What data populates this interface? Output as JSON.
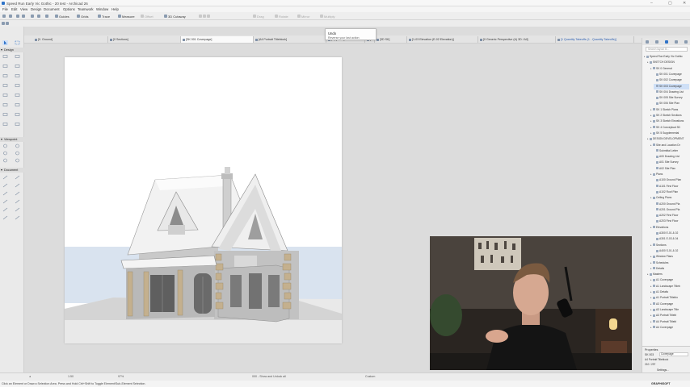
{
  "window": {
    "title": "Speed Run Early Vic Gothic - 20 test - Archicad 26",
    "controls": [
      "–",
      "▢",
      "✕"
    ]
  },
  "menu": [
    "File",
    "Edit",
    "View",
    "Design",
    "Document",
    "Options",
    "Teamwork",
    "Window",
    "Help"
  ],
  "toolbar": {
    "guides": "Guides",
    "grids": "Grids",
    "trace": "Trace",
    "measure": "Measure",
    "offset": "Offset",
    "cutaway": "3D Cutaway",
    "drag": "Drag",
    "rotate": "Rotate",
    "mirror": "Mirror",
    "multiply": "Multiply"
  },
  "tooltip": {
    "title": "Undo",
    "desc": "Reverse your last action"
  },
  "tabs": [
    "[0. Ground]",
    "[0 Sections]",
    "[SK 001 Coverpage]",
    "[A4 Portrait Titleblock]",
    "(A) [Undo]",
    "[3D / All]",
    "[3D SK]",
    "[1-03 Elevation (E-02 Elevation)]",
    "[0 Generic Perspective (A) 3D / All]",
    "[1 Quantity Takeoffs (1 - Quantity Takeoffs)]"
  ],
  "toolbox": {
    "sections": [
      "Design",
      "Viewpoint",
      "Document"
    ]
  },
  "navigator": {
    "search": "Search layout B...",
    "items": [
      {
        "label": "Speed Run Early Vic Gothic",
        "level": 0
      },
      {
        "label": "SKETCH DESIGN",
        "level": 1
      },
      {
        "label": "SK 0 General",
        "level": 2
      },
      {
        "label": "SK 001 Coverpage",
        "level": 3
      },
      {
        "label": "SK 002 Coverpage",
        "level": 3
      },
      {
        "label": "SK 003 Coverpage",
        "level": 3,
        "selected": true
      },
      {
        "label": "SK 004 Drawing List",
        "level": 3
      },
      {
        "label": "SK 005 Site Survey",
        "level": 3
      },
      {
        "label": "SK 006 Site Plan",
        "level": 3
      },
      {
        "label": "SK 1 Sketch Plans",
        "level": 2
      },
      {
        "label": "SK 2 Sketch Sections",
        "level": 2
      },
      {
        "label": "SK 3 Sketch Elevations",
        "level": 2
      },
      {
        "label": "SK 4 Conceptual 3D",
        "level": 2
      },
      {
        "label": "SK 5 Supplemental",
        "level": 2
      },
      {
        "label": "DESIGN DEVELOPMENT",
        "level": 1
      },
      {
        "label": "Site and Location Dr",
        "level": 2
      },
      {
        "label": "Submittal Letter",
        "level": 3
      },
      {
        "label": "A00 Drawing List",
        "level": 3
      },
      {
        "label": "A01 Site Survey",
        "level": 3
      },
      {
        "label": "A02 Site Plan",
        "level": 3
      },
      {
        "label": "Plans",
        "level": 2
      },
      {
        "label": "A100 Ground Plan",
        "level": 3
      },
      {
        "label": "A101 First Floor",
        "level": 3
      },
      {
        "label": "A102 Roof Plan",
        "level": 3
      },
      {
        "label": "Ceiling Plans",
        "level": 2
      },
      {
        "label": "A200 Ground Pla",
        "level": 3
      },
      {
        "label": "A201 Ground Pla",
        "level": 3
      },
      {
        "label": "A202 First Floor",
        "level": 3
      },
      {
        "label": "A203 First Floor",
        "level": 3
      },
      {
        "label": "Elevations",
        "level": 2
      },
      {
        "label": "A300 E-01 & 02",
        "level": 3
      },
      {
        "label": "A301 E-03 & 04",
        "level": 3
      },
      {
        "label": "Sections",
        "level": 2
      },
      {
        "label": "A400 S-01 & 02",
        "level": 3
      },
      {
        "label": "Window Plans",
        "level": 2
      },
      {
        "label": "Schedules",
        "level": 2
      },
      {
        "label": "Details",
        "level": 2
      },
      {
        "label": "Masters",
        "level": 1
      },
      {
        "label": "A1 Coverpage",
        "level": 2
      },
      {
        "label": "A1 Landscape Titleb",
        "level": 2
      },
      {
        "label": "A1 Details",
        "level": 2
      },
      {
        "label": "A1 Portrait Titleblo",
        "level": 2
      },
      {
        "label": "A3 Coverpage",
        "level": 2
      },
      {
        "label": "A3 Landscape Title",
        "level": 2
      },
      {
        "label": "A3 Portrait Titlebl",
        "level": 2
      },
      {
        "label": "A4 Portrait Titlebl",
        "level": 2
      },
      {
        "label": "A4 Coverpage",
        "level": 2
      }
    ],
    "properties_label": "Properties",
    "properties_id": "SK 003",
    "properties_name": "Coverpage",
    "master_name": "A4 Portrait Titleblock",
    "size": "210 / 297",
    "settings": "Settings..."
  },
  "status": {
    "zoom": "97%",
    "scale": "1:50",
    "renovation": "000 - Show and Unlock all",
    "custom": "Custom"
  },
  "hint": "Click an Element or Draw a Selection Area. Press and Hold Ctrl+Shift to Toggle Element/Sub-Element Selection.",
  "brand": "GRAPHISOFT"
}
